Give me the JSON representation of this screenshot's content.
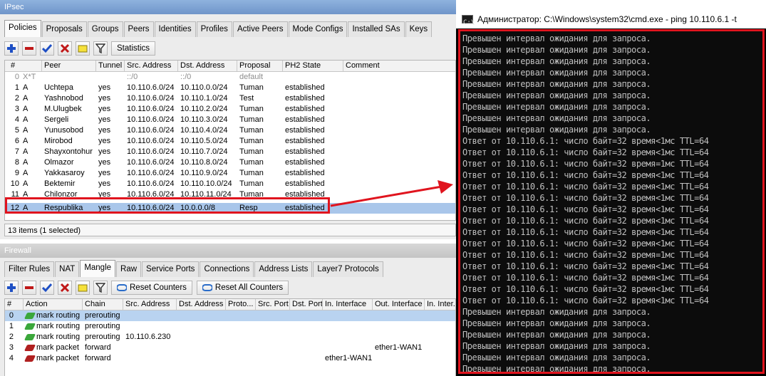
{
  "ipsec": {
    "title": "IPsec",
    "tabs": [
      "Policies",
      "Proposals",
      "Groups",
      "Peers",
      "Identities",
      "Profiles",
      "Active Peers",
      "Mode Configs",
      "Installed SAs",
      "Keys"
    ],
    "active_tab": "Policies",
    "toolbar": {
      "statistics_label": "Statistics"
    },
    "columns": [
      "#",
      "Peer",
      "Tunnel",
      "Src. Address",
      "Dst. Address",
      "Proposal",
      "PH2 State",
      "Comment"
    ],
    "rows": [
      {
        "num": "0",
        "flags": "X*T",
        "peer": "",
        "tunnel": "",
        "src": "::/0",
        "dst": "::/0",
        "proposal": "default",
        "ph2": "",
        "comment": ""
      },
      {
        "num": "1",
        "flags": "A",
        "peer": "Uchtepa",
        "tunnel": "yes",
        "src": "10.110.6.0/24",
        "dst": "10.110.0.0/24",
        "proposal": "Tuman",
        "ph2": "established",
        "comment": ""
      },
      {
        "num": "2",
        "flags": "A",
        "peer": "Yashnobod",
        "tunnel": "yes",
        "src": "10.110.6.0/24",
        "dst": "10.110.1.0/24",
        "proposal": "Test",
        "ph2": "established",
        "comment": ""
      },
      {
        "num": "3",
        "flags": "A",
        "peer": "M.Ulugbek",
        "tunnel": "yes",
        "src": "10.110.6.0/24",
        "dst": "10.110.2.0/24",
        "proposal": "Tuman",
        "ph2": "established",
        "comment": ""
      },
      {
        "num": "4",
        "flags": "A",
        "peer": "Sergeli",
        "tunnel": "yes",
        "src": "10.110.6.0/24",
        "dst": "10.110.3.0/24",
        "proposal": "Tuman",
        "ph2": "established",
        "comment": ""
      },
      {
        "num": "5",
        "flags": "A",
        "peer": "Yunusobod",
        "tunnel": "yes",
        "src": "10.110.6.0/24",
        "dst": "10.110.4.0/24",
        "proposal": "Tuman",
        "ph2": "established",
        "comment": ""
      },
      {
        "num": "6",
        "flags": "A",
        "peer": "Mirobod",
        "tunnel": "yes",
        "src": "10.110.6.0/24",
        "dst": "10.110.5.0/24",
        "proposal": "Tuman",
        "ph2": "established",
        "comment": ""
      },
      {
        "num": "7",
        "flags": "A",
        "peer": "Shayxontohur",
        "tunnel": "yes",
        "src": "10.110.6.0/24",
        "dst": "10.110.7.0/24",
        "proposal": "Tuman",
        "ph2": "established",
        "comment": ""
      },
      {
        "num": "8",
        "flags": "A",
        "peer": "Olmazor",
        "tunnel": "yes",
        "src": "10.110.6.0/24",
        "dst": "10.110.8.0/24",
        "proposal": "Tuman",
        "ph2": "established",
        "comment": ""
      },
      {
        "num": "9",
        "flags": "A",
        "peer": "Yakkasaroy",
        "tunnel": "yes",
        "src": "10.110.6.0/24",
        "dst": "10.110.9.0/24",
        "proposal": "Tuman",
        "ph2": "established",
        "comment": ""
      },
      {
        "num": "10",
        "flags": "A",
        "peer": "Bektemir",
        "tunnel": "yes",
        "src": "10.110.6.0/24",
        "dst": "10.110.10.0/24",
        "proposal": "Tuman",
        "ph2": "established",
        "comment": ""
      },
      {
        "num": "11",
        "flags": "A",
        "peer": "Chilonzor",
        "tunnel": "yes",
        "src": "10.110.6.0/24",
        "dst": "10.110.11.0/24",
        "proposal": "Tuman",
        "ph2": "established",
        "comment": ""
      },
      {
        "num": "12",
        "flags": "A",
        "peer": "Respublika",
        "tunnel": "yes",
        "src": "10.110.6.0/24",
        "dst": "10.0.0.0/8",
        "proposal": "Resp",
        "ph2": "established",
        "comment": ""
      }
    ],
    "selected_row": 12,
    "status": "13 items (1 selected)"
  },
  "firewall": {
    "title": "Firewall",
    "tabs": [
      "Filter Rules",
      "NAT",
      "Mangle",
      "Raw",
      "Service Ports",
      "Connections",
      "Address Lists",
      "Layer7 Protocols"
    ],
    "active_tab": "Mangle",
    "toolbar": {
      "reset_label": "Reset Counters",
      "reset_all_label": "Reset All Counters"
    },
    "columns": [
      "#",
      "Action",
      "Chain",
      "Src. Address",
      "Dst. Address",
      "Proto...",
      "Src. Port",
      "Dst. Port",
      "In. Interface",
      "Out. Interface",
      "In. Inter..."
    ],
    "rows": [
      {
        "num": "0",
        "action": "mark routing",
        "action_icon": "green-check",
        "chain": "prerouting",
        "src": "",
        "in_if": "",
        "out_if": ""
      },
      {
        "num": "1",
        "action": "mark routing",
        "action_icon": "green-check",
        "chain": "prerouting",
        "src": "",
        "in_if": "",
        "out_if": ""
      },
      {
        "num": "2",
        "action": "mark routing",
        "action_icon": "green-check",
        "chain": "prerouting",
        "src": "10.110.6.230",
        "in_if": "",
        "out_if": ""
      },
      {
        "num": "3",
        "action": "mark packet",
        "action_icon": "red-pencil",
        "chain": "forward",
        "src": "",
        "in_if": "",
        "out_if": "ether1-WAN1"
      },
      {
        "num": "4",
        "action": "mark packet",
        "action_icon": "red-pencil",
        "chain": "forward",
        "src": "",
        "in_if": "ether1-WAN1",
        "out_if": ""
      }
    ]
  },
  "cmd": {
    "title": "Администратор: C:\\Windows\\system32\\cmd.exe - ping  10.110.6.1 -t",
    "lines": [
      "Превышен интервал ожидания для запроса.",
      "Превышен интервал ожидания для запроса.",
      "Превышен интервал ожидания для запроса.",
      "Превышен интервал ожидания для запроса.",
      "Превышен интервал ожидания для запроса.",
      "Превышен интервал ожидания для запроса.",
      "Превышен интервал ожидания для запроса.",
      "Превышен интервал ожидания для запроса.",
      "Превышен интервал ожидания для запроса.",
      "Ответ от 10.110.6.1: число байт=32 время<1мс TTL=64",
      "Ответ от 10.110.6.1: число байт=32 время<1мс TTL=64",
      "Ответ от 10.110.6.1: число байт=32 время=1мс TTL=64",
      "Ответ от 10.110.6.1: число байт=32 время<1мс TTL=64",
      "Ответ от 10.110.6.1: число байт=32 время<1мс TTL=64",
      "Ответ от 10.110.6.1: число байт=32 время<1мс TTL=64",
      "Ответ от 10.110.6.1: число байт=32 время<1мс TTL=64",
      "Ответ от 10.110.6.1: число байт=32 время<1мс TTL=64",
      "Ответ от 10.110.6.1: число байт=32 время<1мс TTL=64",
      "Ответ от 10.110.6.1: число байт=32 время<1мс TTL=64",
      "Ответ от 10.110.6.1: число байт=32 время=1мс TTL=64",
      "Ответ от 10.110.6.1: число байт=32 время<1мс TTL=64",
      "Ответ от 10.110.6.1: число байт=32 время<1мс TTL=64",
      "Ответ от 10.110.6.1: число байт=32 время<1мс TTL=64",
      "Ответ от 10.110.6.1: число байт=32 время<1мс TTL=64",
      "Превышен интервал ожидания для запроса.",
      "Превышен интервал ожидания для запроса.",
      "Превышен интервал ожидания для запроса.",
      "Превышен интервал ожидания для запроса.",
      "Превышен интервал ожидания для запроса.",
      "Превышен интервал ожидания для запроса."
    ]
  },
  "colors": {
    "highlight_red": "#e0141e",
    "selection_blue": "#a9c6ea",
    "console_text": "#c0c0c0"
  }
}
